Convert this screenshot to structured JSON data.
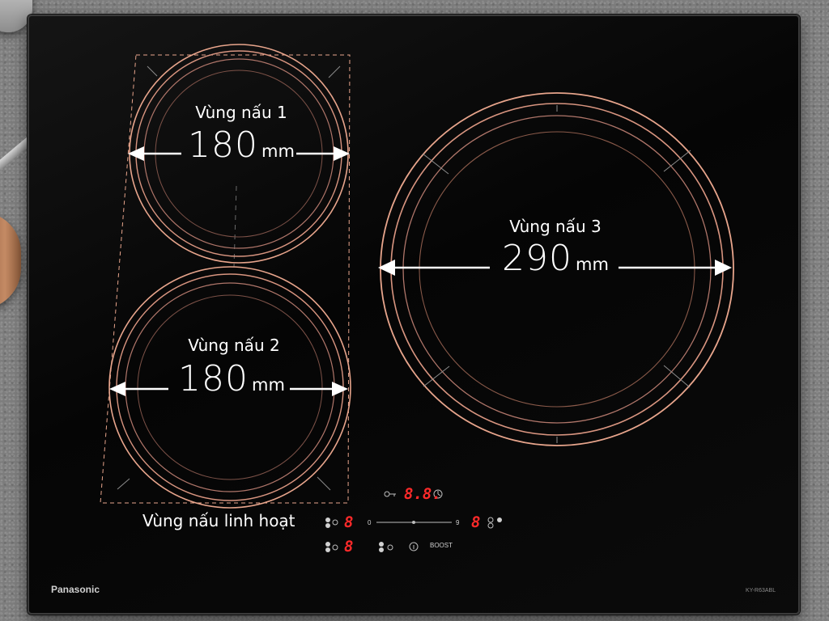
{
  "zones": [
    {
      "title": "Vùng nấu 1",
      "size_value": "180",
      "size_unit": "mm"
    },
    {
      "title": "Vùng nấu 2",
      "size_value": "180",
      "size_unit": "mm"
    },
    {
      "title": "Vùng nấu 3",
      "size_value": "290",
      "size_unit": "mm"
    }
  ],
  "flex_zone_label": "Vùng nấu linh hoạt",
  "brand": "Panasonic",
  "model": "KY-R63ABL",
  "controls": {
    "timer_display": "8.8.",
    "left_top_level": "8",
    "left_bottom_level": "8",
    "right_level": "8",
    "slider_min": "0",
    "slider_max": "9",
    "boost_label": "BOOST"
  },
  "colors": {
    "ring": "#e8a58c",
    "ring_dim": "#8a5a4a",
    "display_red": "#ff2a2a"
  }
}
